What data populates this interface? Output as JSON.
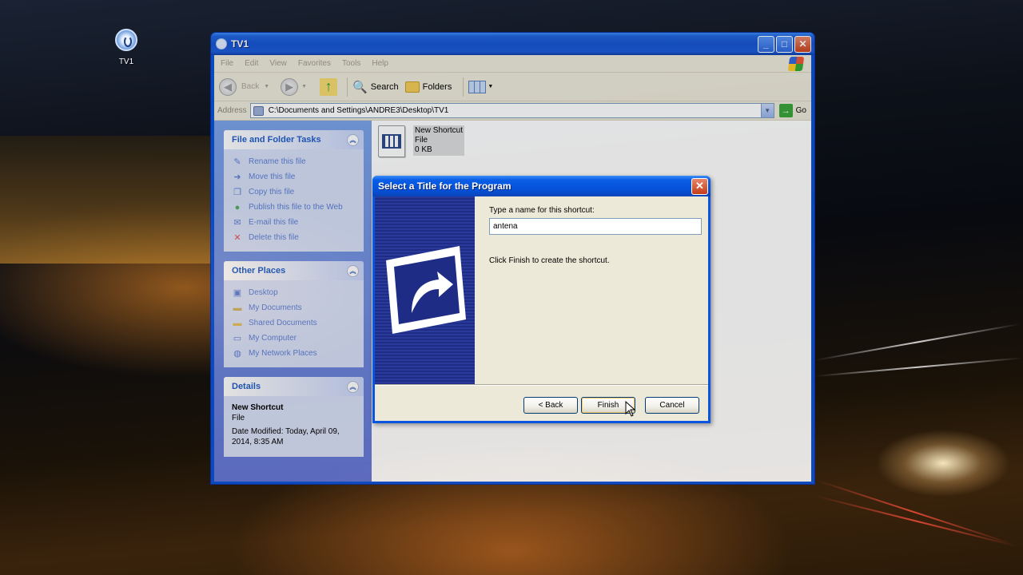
{
  "desktop": {
    "icon_label": "TV1"
  },
  "window": {
    "title": "TV1",
    "menu": [
      "File",
      "Edit",
      "View",
      "Favorites",
      "Tools",
      "Help"
    ],
    "toolbar": {
      "back_label": "Back",
      "search_label": "Search",
      "folders_label": "Folders"
    },
    "address": {
      "label": "Address",
      "value": "C:\\Documents and Settings\\ANDRE3\\Desktop\\TV1",
      "go_label": "Go"
    }
  },
  "file_tasks": {
    "title": "File and Folder Tasks",
    "items": [
      {
        "label": "Rename this file",
        "icon": "rename-icon"
      },
      {
        "label": "Move this file",
        "icon": "move-icon"
      },
      {
        "label": "Copy this file",
        "icon": "copy-icon"
      },
      {
        "label": "Publish this file to the Web",
        "icon": "globe-icon"
      },
      {
        "label": "E-mail this file",
        "icon": "email-icon"
      },
      {
        "label": "Delete this file",
        "icon": "delete-icon"
      }
    ]
  },
  "other_places": {
    "title": "Other Places",
    "items": [
      {
        "label": "Desktop",
        "icon": "desktop-icon"
      },
      {
        "label": "My Documents",
        "icon": "documents-icon"
      },
      {
        "label": "Shared Documents",
        "icon": "folder-icon"
      },
      {
        "label": "My Computer",
        "icon": "computer-icon"
      },
      {
        "label": "My Network Places",
        "icon": "network-icon"
      }
    ]
  },
  "details": {
    "title": "Details",
    "name": "New Shortcut",
    "type": "File",
    "modified": "Date Modified: Today, April 09, 2014, 8:35 AM"
  },
  "file_item": {
    "name": "New Shortcut",
    "type": "File",
    "size": "0 KB"
  },
  "dialog": {
    "title": "Select a Title for the Program",
    "prompt": "Type a name for this shortcut:",
    "input_value": "antena",
    "hint": "Click Finish to create the shortcut.",
    "back_label": "< Back",
    "finish_label": "Finish",
    "cancel_label": "Cancel"
  },
  "colors": {
    "xp_blue": "#0a55e0",
    "task_link": "#215dc6",
    "dialog_bg": "#ece9d8"
  }
}
